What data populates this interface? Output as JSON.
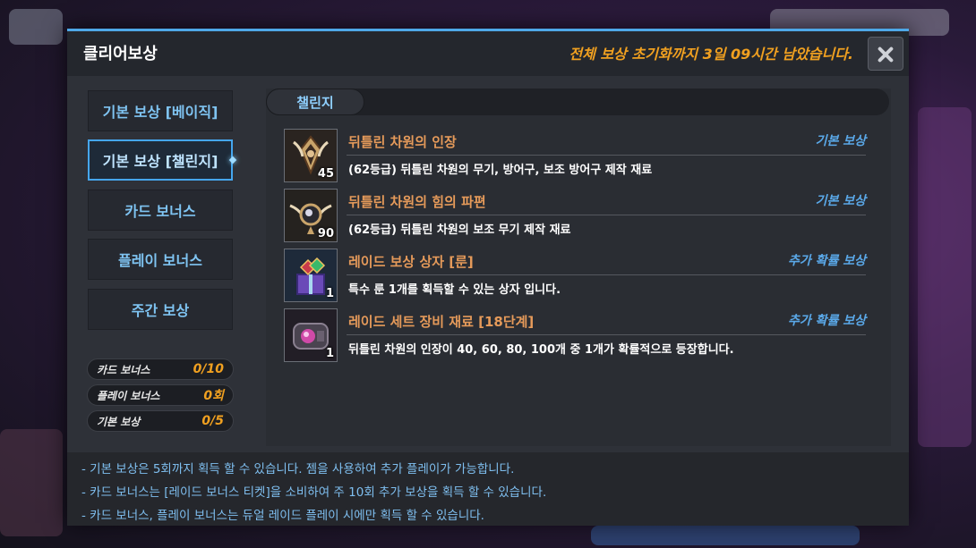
{
  "window": {
    "title": "클리어보상",
    "reset_notice": "전체 보상 초기화까지 3일 09시간 남았습니다."
  },
  "sidebar": {
    "items": [
      {
        "label": "기본 보상 [베이직]",
        "active": false
      },
      {
        "label": "기본 보상 [챌린지]",
        "active": true
      },
      {
        "label": "카드 보너스",
        "active": false
      },
      {
        "label": "플레이 보너스",
        "active": false
      },
      {
        "label": "주간 보상",
        "active": false
      }
    ],
    "stats": [
      {
        "label": "카드 보너스",
        "value": "0/10"
      },
      {
        "label": "플레이 보너스",
        "value": "0회"
      },
      {
        "label": "기본 보상",
        "value": "0/5"
      }
    ]
  },
  "content": {
    "tab_label": "챌린지",
    "rewards": [
      {
        "name": "뒤틀린 차원의 인장",
        "type": "기본 보상",
        "desc": "(62등급) 뒤틀린 차원의 무기, 방어구, 보조 방어구 제작 재료",
        "qty": "45",
        "icon": "seal-icon"
      },
      {
        "name": "뒤틀린 차원의 힘의 파편",
        "type": "기본 보상",
        "desc": "(62등급) 뒤틀린 차원의 보조 무기 제작 재료",
        "qty": "90",
        "icon": "fragment-icon"
      },
      {
        "name": "레이드 보상 상자 [룬]",
        "type": "추가 확률 보상",
        "desc": "특수 룬 1개를 획득할 수 있는 상자 입니다.",
        "qty": "1",
        "icon": "rune-box-icon"
      },
      {
        "name": "레이드 세트 장비 재료 [18단계]",
        "type": "추가 확률 보상",
        "desc": "뒤틀린 차원의 인장이 40, 60, 80, 100개 중 1개가 확률적으로 등장합니다.",
        "qty": "1",
        "icon": "gear-material-icon"
      }
    ]
  },
  "notes": [
    "- 기본 보상은 5회까지 획득 할 수 있습니다. 젬을 사용하여 추가 플레이가 가능합니다.",
    "- 카드 보너스는 [레이드 보너스 티켓]을 소비하여 주 10회 추가 보상을 획득 할 수 있습니다.",
    "- 카드 보너스, 플레이 보너스는 듀얼 레이드 플레이 시에만 획득 할 수 있습니다."
  ],
  "colors": {
    "accent": "#4ea8e8",
    "orange": "#f0a020",
    "item_name": "#e59a5a",
    "note_text": "#7fbff0"
  }
}
